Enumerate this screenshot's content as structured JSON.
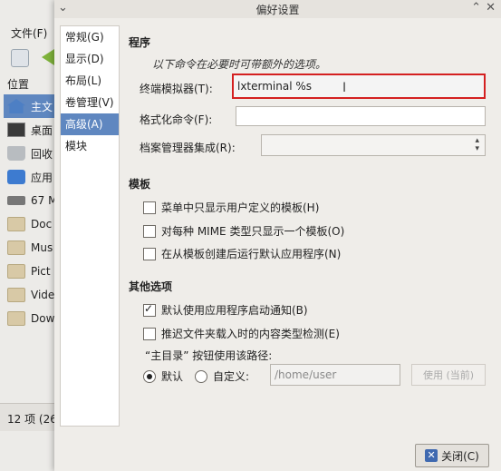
{
  "background_window": {
    "menu_file": "文件(F)",
    "places_title": "位置",
    "places": [
      "主文",
      "桌面",
      "回收",
      "应用",
      "67 M",
      "Doc",
      "Mus",
      "Pict",
      "Vide",
      "Dow"
    ],
    "status": "12 项 (26"
  },
  "dialog": {
    "title": "偏好设置",
    "sidebar": [
      "常规(G)",
      "显示(D)",
      "布局(L)",
      "卷管理(V)",
      "高级(A)",
      "模块"
    ],
    "active_tab": "高级(A)",
    "program": {
      "heading": "程序",
      "note": "以下命令在必要时可带额外的选项。",
      "terminal_label": "终端模拟器(T):",
      "terminal_value": "lxterminal %s",
      "format_label": "格式化命令(F):",
      "format_value": "",
      "archiver_label": "档案管理器集成(R):",
      "archiver_value": ""
    },
    "templates": {
      "heading": "模板",
      "options": [
        {
          "label": "菜单中只显示用户定义的模板(H)",
          "checked": false
        },
        {
          "label": "对每种 MIME 类型只显示一个模板(O)",
          "checked": false
        },
        {
          "label": "在从模板创建后运行默认应用程序(N)",
          "checked": false
        }
      ]
    },
    "other": {
      "heading": "其他选项",
      "options": [
        {
          "label": "默认使用应用程序启动通知(B)",
          "checked": true
        },
        {
          "label": "推迟文件夹载入时的内容类型检测(E)",
          "checked": false
        }
      ],
      "home_path_label": "“主目录” 按钮使用该路径:",
      "radio_default": "默认",
      "radio_custom": "自定义:",
      "custom_path": "/home/user",
      "use_current_button": "使用 (当前)"
    },
    "close_button": "关闭(C)"
  }
}
